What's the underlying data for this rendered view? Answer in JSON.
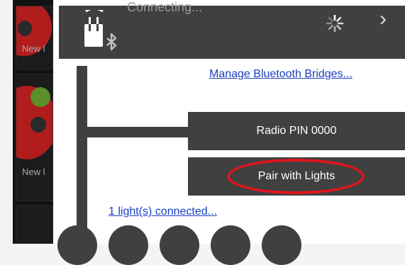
{
  "background": {
    "tiles": [
      {
        "label": "New l"
      },
      {
        "label": "New l"
      }
    ]
  },
  "header": {
    "status_text": "Connecting...",
    "icons": {
      "bridge": "bluetooth-bridge-icon",
      "spinner": "loading-spinner-icon",
      "chevron": "chevron-right-icon",
      "chevron_glyph": "›"
    }
  },
  "links": {
    "manage_bridges": "Manage Bluetooth Bridges...",
    "lights_connected": "1 light(s) connected..."
  },
  "buttons": {
    "radio_pin": "Radio PIN 0000",
    "pair": "Pair with Lights"
  },
  "colors": {
    "bar": "#404040",
    "link": "#1a3fbf",
    "highlight_ring": "#e0141c"
  },
  "lights_count_visible": 5
}
